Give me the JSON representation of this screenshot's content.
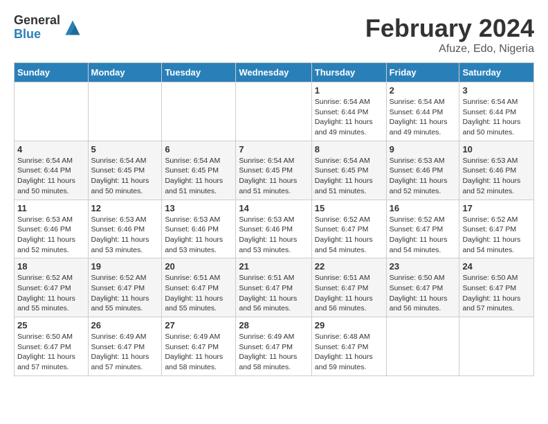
{
  "logo": {
    "general": "General",
    "blue": "Blue"
  },
  "title": "February 2024",
  "location": "Afuze, Edo, Nigeria",
  "days_of_week": [
    "Sunday",
    "Monday",
    "Tuesday",
    "Wednesday",
    "Thursday",
    "Friday",
    "Saturday"
  ],
  "weeks": [
    [
      {
        "day": "",
        "info": ""
      },
      {
        "day": "",
        "info": ""
      },
      {
        "day": "",
        "info": ""
      },
      {
        "day": "",
        "info": ""
      },
      {
        "day": "1",
        "info": "Sunrise: 6:54 AM\nSunset: 6:44 PM\nDaylight: 11 hours\nand 49 minutes."
      },
      {
        "day": "2",
        "info": "Sunrise: 6:54 AM\nSunset: 6:44 PM\nDaylight: 11 hours\nand 49 minutes."
      },
      {
        "day": "3",
        "info": "Sunrise: 6:54 AM\nSunset: 6:44 PM\nDaylight: 11 hours\nand 50 minutes."
      }
    ],
    [
      {
        "day": "4",
        "info": "Sunrise: 6:54 AM\nSunset: 6:44 PM\nDaylight: 11 hours\nand 50 minutes."
      },
      {
        "day": "5",
        "info": "Sunrise: 6:54 AM\nSunset: 6:45 PM\nDaylight: 11 hours\nand 50 minutes."
      },
      {
        "day": "6",
        "info": "Sunrise: 6:54 AM\nSunset: 6:45 PM\nDaylight: 11 hours\nand 51 minutes."
      },
      {
        "day": "7",
        "info": "Sunrise: 6:54 AM\nSunset: 6:45 PM\nDaylight: 11 hours\nand 51 minutes."
      },
      {
        "day": "8",
        "info": "Sunrise: 6:54 AM\nSunset: 6:45 PM\nDaylight: 11 hours\nand 51 minutes."
      },
      {
        "day": "9",
        "info": "Sunrise: 6:53 AM\nSunset: 6:46 PM\nDaylight: 11 hours\nand 52 minutes."
      },
      {
        "day": "10",
        "info": "Sunrise: 6:53 AM\nSunset: 6:46 PM\nDaylight: 11 hours\nand 52 minutes."
      }
    ],
    [
      {
        "day": "11",
        "info": "Sunrise: 6:53 AM\nSunset: 6:46 PM\nDaylight: 11 hours\nand 52 minutes."
      },
      {
        "day": "12",
        "info": "Sunrise: 6:53 AM\nSunset: 6:46 PM\nDaylight: 11 hours\nand 53 minutes."
      },
      {
        "day": "13",
        "info": "Sunrise: 6:53 AM\nSunset: 6:46 PM\nDaylight: 11 hours\nand 53 minutes."
      },
      {
        "day": "14",
        "info": "Sunrise: 6:53 AM\nSunset: 6:46 PM\nDaylight: 11 hours\nand 53 minutes."
      },
      {
        "day": "15",
        "info": "Sunrise: 6:52 AM\nSunset: 6:47 PM\nDaylight: 11 hours\nand 54 minutes."
      },
      {
        "day": "16",
        "info": "Sunrise: 6:52 AM\nSunset: 6:47 PM\nDaylight: 11 hours\nand 54 minutes."
      },
      {
        "day": "17",
        "info": "Sunrise: 6:52 AM\nSunset: 6:47 PM\nDaylight: 11 hours\nand 54 minutes."
      }
    ],
    [
      {
        "day": "18",
        "info": "Sunrise: 6:52 AM\nSunset: 6:47 PM\nDaylight: 11 hours\nand 55 minutes."
      },
      {
        "day": "19",
        "info": "Sunrise: 6:52 AM\nSunset: 6:47 PM\nDaylight: 11 hours\nand 55 minutes."
      },
      {
        "day": "20",
        "info": "Sunrise: 6:51 AM\nSunset: 6:47 PM\nDaylight: 11 hours\nand 55 minutes."
      },
      {
        "day": "21",
        "info": "Sunrise: 6:51 AM\nSunset: 6:47 PM\nDaylight: 11 hours\nand 56 minutes."
      },
      {
        "day": "22",
        "info": "Sunrise: 6:51 AM\nSunset: 6:47 PM\nDaylight: 11 hours\nand 56 minutes."
      },
      {
        "day": "23",
        "info": "Sunrise: 6:50 AM\nSunset: 6:47 PM\nDaylight: 11 hours\nand 56 minutes."
      },
      {
        "day": "24",
        "info": "Sunrise: 6:50 AM\nSunset: 6:47 PM\nDaylight: 11 hours\nand 57 minutes."
      }
    ],
    [
      {
        "day": "25",
        "info": "Sunrise: 6:50 AM\nSunset: 6:47 PM\nDaylight: 11 hours\nand 57 minutes."
      },
      {
        "day": "26",
        "info": "Sunrise: 6:49 AM\nSunset: 6:47 PM\nDaylight: 11 hours\nand 57 minutes."
      },
      {
        "day": "27",
        "info": "Sunrise: 6:49 AM\nSunset: 6:47 PM\nDaylight: 11 hours\nand 58 minutes."
      },
      {
        "day": "28",
        "info": "Sunrise: 6:49 AM\nSunset: 6:47 PM\nDaylight: 11 hours\nand 58 minutes."
      },
      {
        "day": "29",
        "info": "Sunrise: 6:48 AM\nSunset: 6:47 PM\nDaylight: 11 hours\nand 59 minutes."
      },
      {
        "day": "",
        "info": ""
      },
      {
        "day": "",
        "info": ""
      }
    ]
  ]
}
